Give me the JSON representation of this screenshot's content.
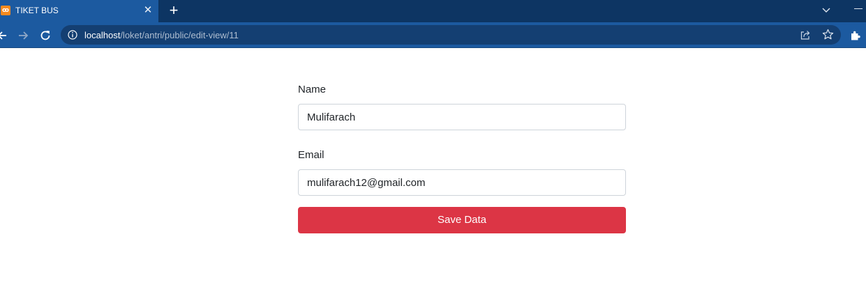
{
  "browser": {
    "tab": {
      "favicon_text": "XAMPP",
      "title": "TIKET BUS",
      "close_glyph": "✕"
    },
    "new_tab_glyph": "+",
    "address": {
      "host": "localhost",
      "path": "/loket/antri/public/edit-view/11"
    },
    "icons": {
      "back": "arrow-left-icon",
      "forward": "arrow-right-icon",
      "reload": "reload-icon",
      "info": "info-icon",
      "share": "share-icon",
      "bookmark": "star-icon",
      "extensions": "puzzle-icon",
      "tab_list": "chevron-down-icon",
      "minimize": "minimize-icon"
    },
    "colors": {
      "tabstrip": "#0d3563",
      "toolbar": "#1c5aa0",
      "omnibox": "#143f72"
    }
  },
  "form": {
    "name_label": "Name",
    "name_value": "Mulifarach",
    "email_label": "Email",
    "email_value": "mulifarach12@gmail.com",
    "submit_label": "Save Data",
    "colors": {
      "submit_bg": "#dc3545",
      "input_border": "#ced4da"
    }
  }
}
